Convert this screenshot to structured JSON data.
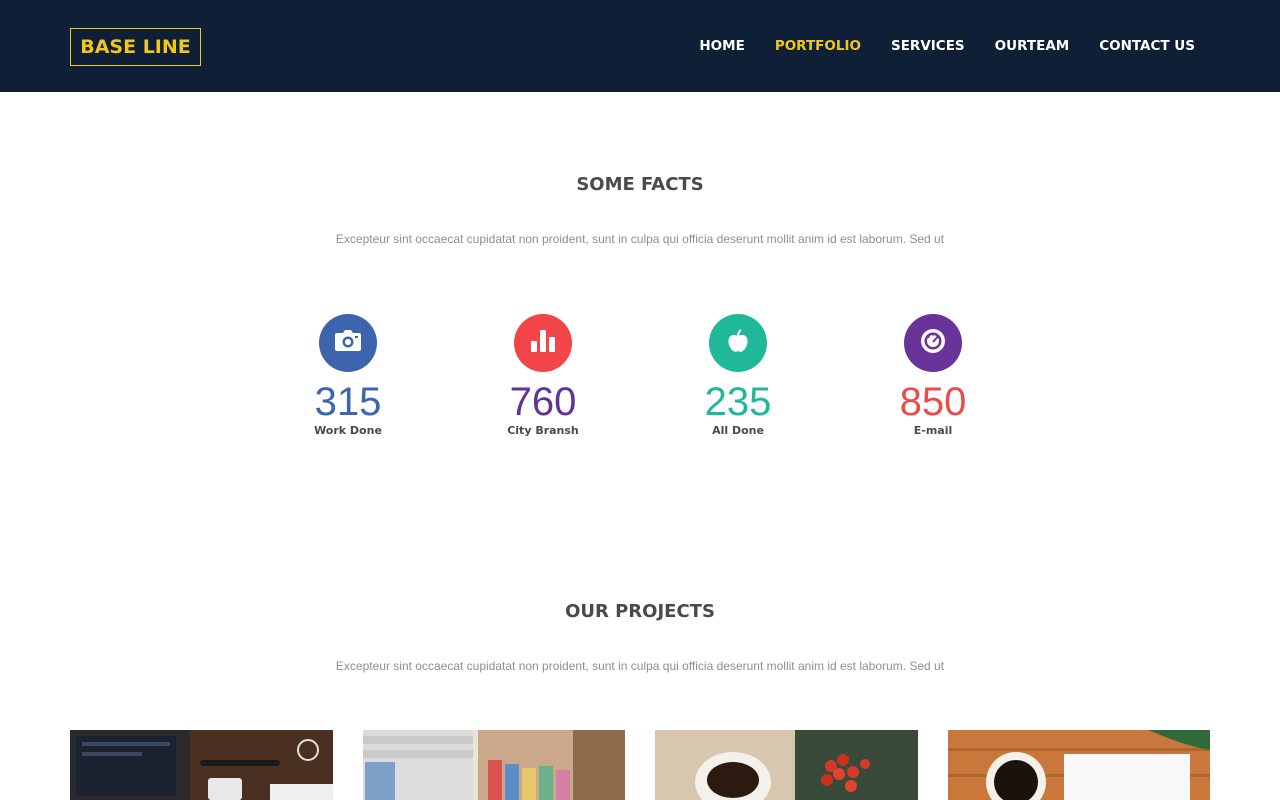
{
  "brand": {
    "logo": "BASE LINE"
  },
  "nav": {
    "items": [
      {
        "label": "HOME",
        "active": false
      },
      {
        "label": "PORTFOLIO",
        "active": true
      },
      {
        "label": "SERVICES",
        "active": false
      },
      {
        "label": "OURTEAM",
        "active": false
      },
      {
        "label": "CONTACT US",
        "active": false
      }
    ]
  },
  "facts": {
    "title": "SOME FACTS",
    "subtitle": "Excepteur sint occaecat cupidatat non proident, sunt in culpa qui officia deserunt mollit anim id est laborum. Sed ut",
    "items": [
      {
        "icon": "camera-icon",
        "value": "315",
        "label": "Work Done",
        "circle_color": "#3d64ad",
        "value_color": "#3d64ad"
      },
      {
        "icon": "bar-chart-icon",
        "value": "760",
        "label": "City Bransh",
        "circle_color": "#f2454a",
        "value_color": "#5f3399"
      },
      {
        "icon": "apple-icon",
        "value": "235",
        "label": "All Done",
        "circle_color": "#1fb99a",
        "value_color": "#1fb99a"
      },
      {
        "icon": "gauge-icon",
        "value": "850",
        "label": "E-mail",
        "circle_color": "#6a3399",
        "value_color": "#ea4b4b"
      }
    ]
  },
  "projects": {
    "title": "OUR PROJECTS",
    "subtitle": "Excepteur sint occaecat cupidatat non proident, sunt in culpa qui officia deserunt mollit anim id est laborum. Sed ut"
  },
  "colors": {
    "header_bg": "#0f1f36",
    "accent": "#f2c71b"
  }
}
